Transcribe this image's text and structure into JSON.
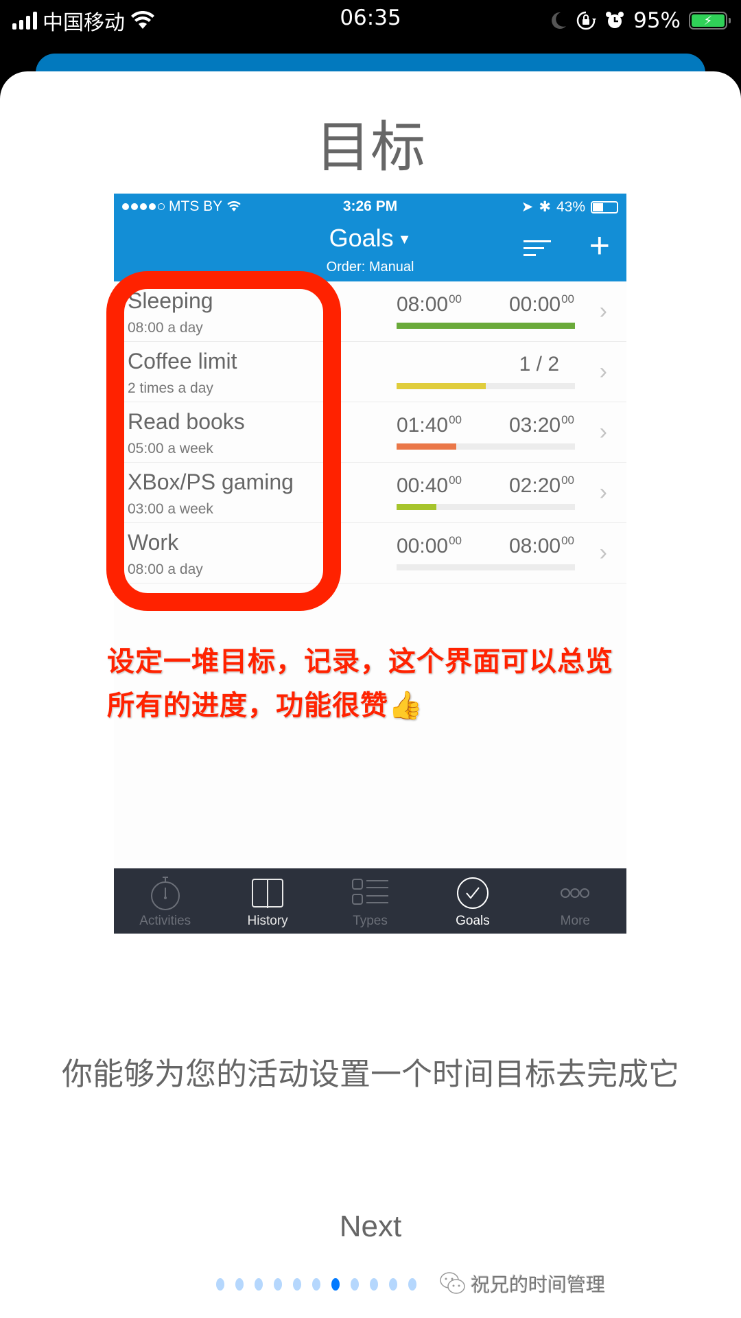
{
  "status_bar": {
    "carrier": "中国移动",
    "time": "06:35",
    "battery_percent": "95%",
    "battery_level": 0.95,
    "icons": [
      "signal-icon",
      "wifi-icon",
      "moon-icon",
      "rotation-lock-icon",
      "alarm-icon",
      "battery-charging-icon"
    ]
  },
  "page": {
    "title": "目标",
    "description": "你能够为您的活动设置一个时间目标去完成它",
    "next_label": "Next",
    "pager": {
      "total": 11,
      "active_index": 6
    },
    "watermark": "祝兄的时间管理"
  },
  "embedded_screenshot": {
    "status_bar": {
      "carrier": "MTS BY",
      "time": "3:26 PM",
      "battery_percent": "43%",
      "battery_level": 0.43
    },
    "nav": {
      "title": "Goals",
      "subtitle": "Order: Manual"
    },
    "goals": [
      {
        "name": "Sleeping",
        "target": "08:00 a day",
        "done": "08:00",
        "done_sec": "00",
        "remaining": "00:00",
        "remaining_sec": "00",
        "progress": 1.0,
        "color": "#6aaa3a"
      },
      {
        "name": "Coffee limit",
        "target": "2 times a day",
        "count": "1 / 2",
        "progress": 0.5,
        "color": "#e0cd3c"
      },
      {
        "name": "Read books",
        "target": "05:00 a week",
        "done": "01:40",
        "done_sec": "00",
        "remaining": "03:20",
        "remaining_sec": "00",
        "progress": 0.333,
        "color": "#ea7748"
      },
      {
        "name": "XBox/PS gaming",
        "target": "03:00 a week",
        "done": "00:40",
        "done_sec": "00",
        "remaining": "02:20",
        "remaining_sec": "00",
        "progress": 0.222,
        "color": "#a6c42c"
      },
      {
        "name": "Work",
        "target": "08:00 a day",
        "done": "00:00",
        "done_sec": "00",
        "remaining": "08:00",
        "remaining_sec": "00",
        "progress": 0.0,
        "color": "#6aaa3a"
      }
    ],
    "tabs": [
      {
        "label": "Activities",
        "icon": "stopwatch-icon",
        "color": "#6b6f78"
      },
      {
        "label": "History",
        "icon": "book-icon",
        "color": "#e8e8e8"
      },
      {
        "label": "Types",
        "icon": "list-icon",
        "color": "#6b6f78"
      },
      {
        "label": "Goals",
        "icon": "goal-check-icon",
        "color": "#ffffff"
      },
      {
        "label": "More",
        "icon": "more-icon",
        "color": "#6b6f78"
      }
    ]
  },
  "annotation": {
    "line1": "设定一堆目标，记录，这个界面可以总览",
    "line2": "所有的进度，功能很赞👍",
    "color": "#ff2200"
  },
  "colors": {
    "accent_blue": "#138ed6",
    "pager_active": "#007aff",
    "pager_inactive": "#b5d7fd"
  }
}
